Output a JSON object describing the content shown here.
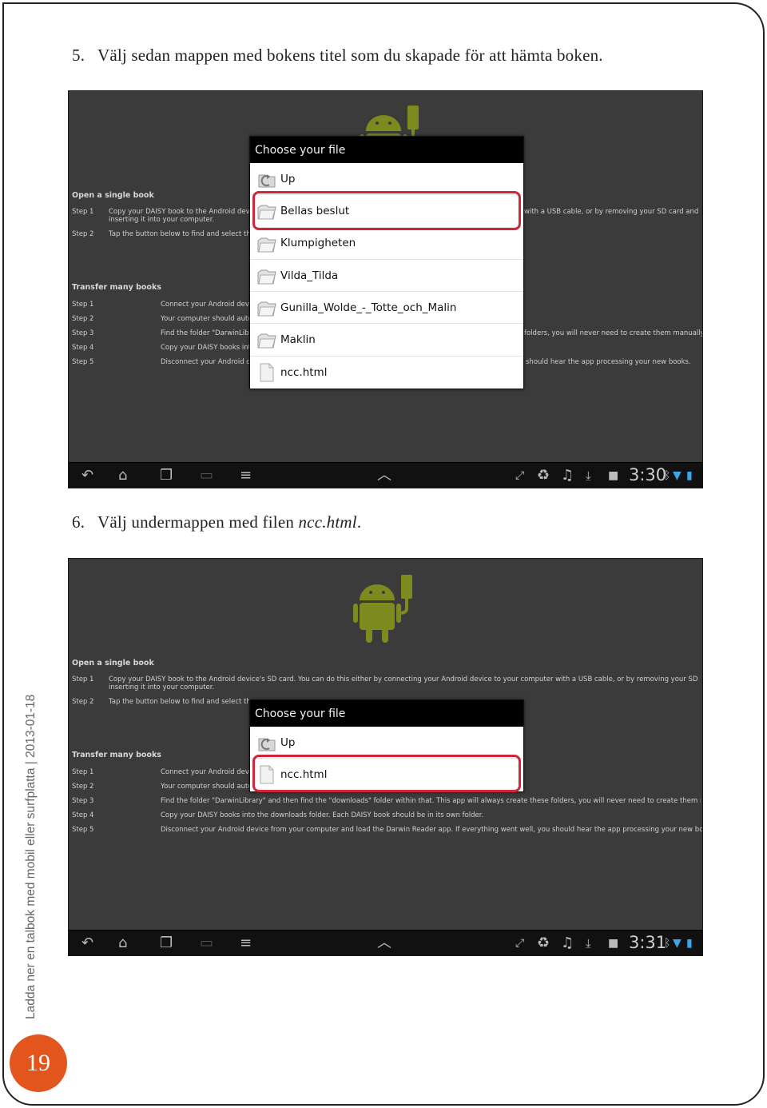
{
  "page_number": "19",
  "side_text": "Ladda ner en talbok med mobil eller surfplatta  |  2013-01-18",
  "step5": {
    "number": "5.",
    "text": "Välj sedan mappen med bokens titel som du skapade för att hämta boken."
  },
  "step6": {
    "number": "6.",
    "text": "Välj undermappen med filen ",
    "filename": "ncc.html",
    "end": "."
  },
  "background_app": {
    "open_single_title": "Open a single book",
    "step1_label": "Step 1",
    "step2_label": "Step 2",
    "step3_label": "Step 3",
    "step4_label": "Step 4",
    "step5_label": "Step 5",
    "single_step1": "Copy your DAISY book to the Android device's SD card.  You can do this either by connecting your Android device to your computer with a USB cable, or by removing your SD card and",
    "single_step1b": "inserting it into your computer.",
    "single_step2": "Tap the button below to find and select the DAISY book you want to read.",
    "transfer_title": "Transfer many books",
    "transfer_step1": "Connect your Android device to your computer with a USB cable.",
    "transfer_step2": "Your computer should automatically detect the device.",
    "transfer_step3": "Find the folder \"DarwinLibrary\" and then find the \"downloads\" folder within that.  This app will always create these folders, you will never need to create them manually",
    "transfer_step4": "Copy your DAISY books into the downloads folder.  Each DAISY book should be in its own folder.",
    "transfer_step5": "Disconnect your Android device from your computer and load the Darwin Reader app.  If everything went well, you should hear the app processing your new books."
  },
  "screenshot1": {
    "dialog_title": "Choose your file",
    "items": [
      "Up",
      "Bellas beslut",
      "Klumpigheten",
      "Vilda_Tilda",
      "Gunilla_Wolde_-_Totte_och_Malin",
      "Maklin",
      "ncc.html"
    ],
    "clock": "3:30"
  },
  "screenshot2": {
    "dialog_title": "Choose your file",
    "items": [
      "Up",
      "ncc.html"
    ],
    "clock": "3:31"
  },
  "colors": {
    "highlight": "#d0253a",
    "page_circle": "#e2561e",
    "android_green": "#7c8a1e"
  }
}
